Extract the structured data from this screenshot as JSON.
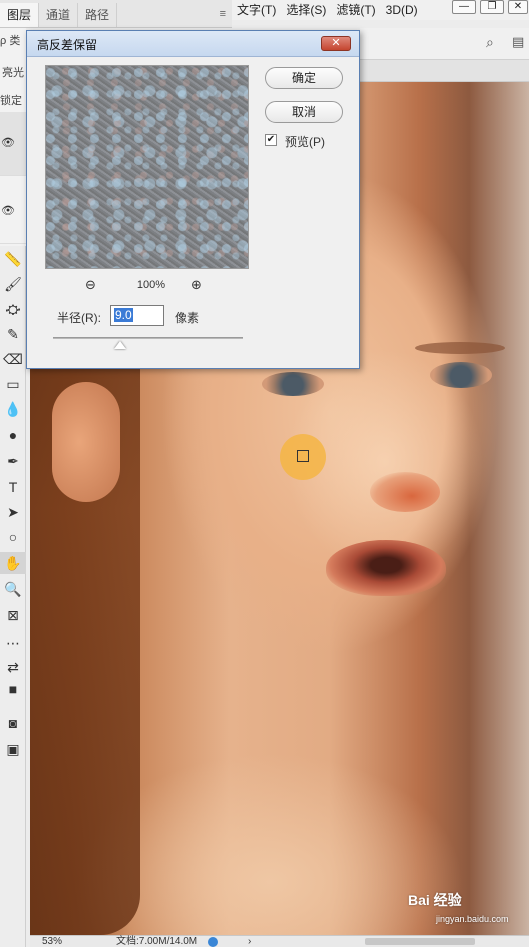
{
  "menubar": {
    "items": [
      "文字(T)",
      "选择(S)",
      "滤镜(T)",
      "3D(D)"
    ]
  },
  "panel": {
    "tabs": [
      "图层",
      "通道",
      "路径"
    ],
    "search_glyph": "ρ 类",
    "mode_label": "亮光",
    "lock_label": "锁定"
  },
  "dialog": {
    "title": "高反差保留",
    "close_glyph": "✕",
    "ok_label": "确定",
    "cancel_label": "取消",
    "preview_label": "预览(P)",
    "preview_checked": "✔",
    "zoom_percent": "100%",
    "radius_label": "半径(R):",
    "radius_value": "9.0",
    "radius_unit": "像素",
    "slider_level": 0.35
  },
  "status": {
    "zoom": "53%",
    "doc_info": "文档:7.00M/14.0M",
    "arrow": "›"
  },
  "watermark": {
    "brand": "Bai 经验",
    "url": "jingyan.baidu.com"
  },
  "icons": {
    "eye": "👁",
    "zoom_out": "⊖",
    "zoom_in": "⊕",
    "tools": [
      "ruler-icon",
      "brush-icon",
      "stamp-icon",
      "history-brush-icon",
      "eraser-icon",
      "gradient-icon",
      "blur-icon",
      "dodge-icon",
      "pen-icon",
      "type-icon",
      "path-select-icon",
      "ellipse-icon",
      "hand-icon",
      "zoom-icon",
      "frame-icon",
      "more-icon",
      "swap-colors-icon",
      "color-swatches-icon",
      "quick-mask-icon",
      "screen-mode-icon"
    ],
    "tool_glyphs": [
      "📏",
      "🖌",
      "⛮",
      "✎",
      "⌫",
      "▭",
      "💧",
      "●",
      "✒",
      "T",
      "➤",
      "○",
      "✋",
      "🔍",
      "⊠",
      "⋯",
      "⇄",
      "■",
      "◙",
      "▣"
    ]
  },
  "colors": {
    "titlebar": "#c6d8ef",
    "close_button": "#c4452f",
    "selection": "#3b7bd6",
    "cursor_ring": "#f4b544"
  }
}
